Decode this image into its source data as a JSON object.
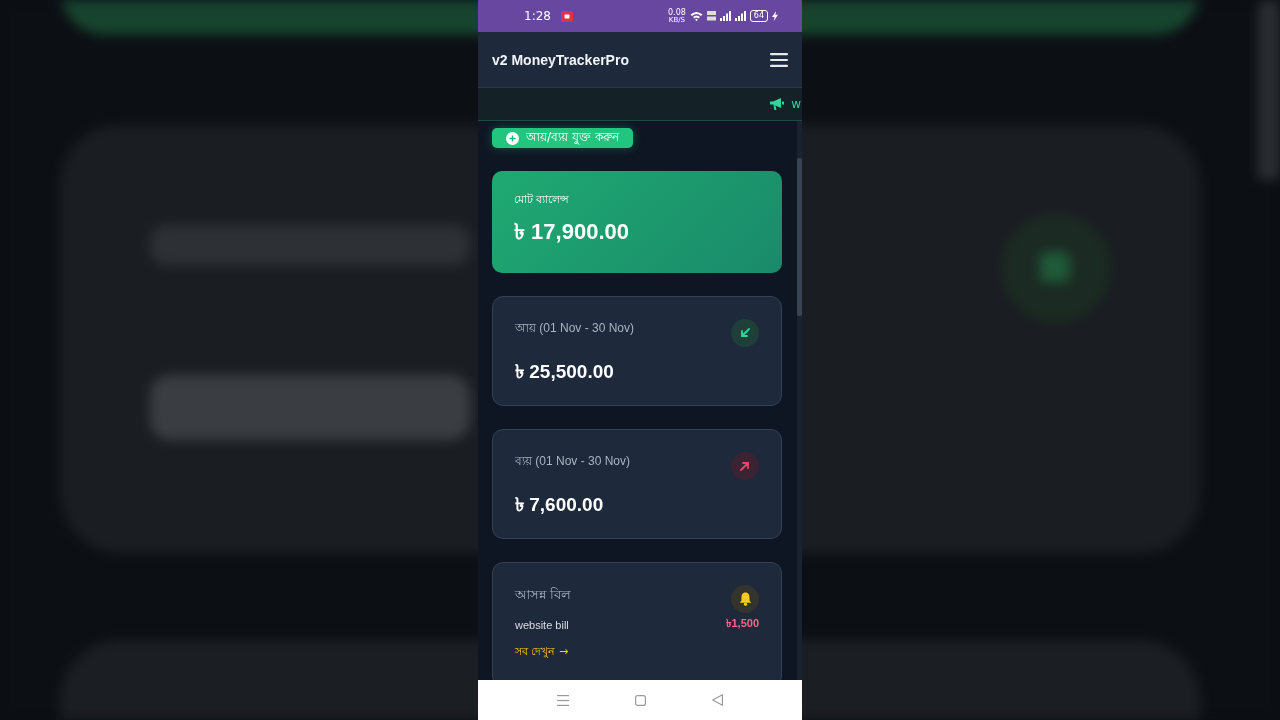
{
  "status_bar": {
    "time": "1:28",
    "net_speed": "0.08",
    "net_unit": "KB/S",
    "battery": "64"
  },
  "header": {
    "title": "v2 MoneyTrackerPro"
  },
  "ticker": {
    "text": "w"
  },
  "add_button": {
    "label": "আয়/ব্যয় যুক্ত করুন"
  },
  "balance": {
    "label": "মোট ব্যালেন্স",
    "amount": "৳ 17,900.00"
  },
  "stats": [
    {
      "kind": "income",
      "label": "আয় (01 Nov - 30 Nov)",
      "amount": "৳ 25,500.00"
    },
    {
      "kind": "expense",
      "label": "ব্যয় (01 Nov - 30 Nov)",
      "amount": "৳ 7,600.00"
    }
  ],
  "bills": {
    "title": "আসন্ন বিল",
    "items": [
      {
        "name": "website bill",
        "amount": "৳1,500"
      }
    ],
    "link": "সব দেখুন →"
  }
}
